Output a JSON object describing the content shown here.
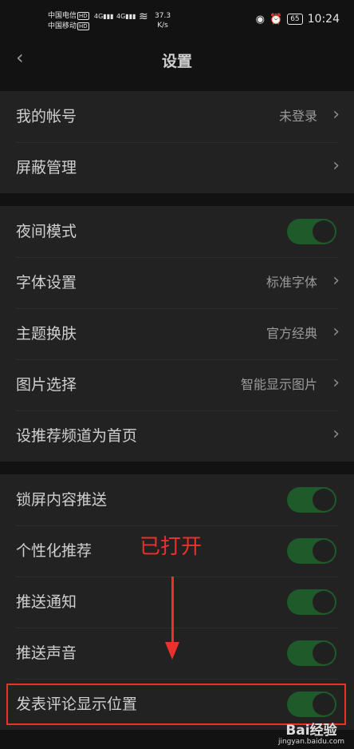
{
  "status": {
    "carrier1": "中国电信",
    "carrier2": "中国移动",
    "hd": "HD",
    "sig": "4G",
    "speed_value": "37.3",
    "speed_unit": "K/s",
    "battery": "65",
    "time": "10:24"
  },
  "header": {
    "back_icon": "chevron-left-icon",
    "title": "设置"
  },
  "groups": [
    {
      "rows": [
        {
          "label": "我的帐号",
          "value": "未登录",
          "type": "link"
        },
        {
          "label": "屏蔽管理",
          "value": "",
          "type": "link"
        }
      ]
    },
    {
      "rows": [
        {
          "label": "夜间模式",
          "type": "toggle",
          "on": true
        },
        {
          "label": "字体设置",
          "value": "标准字体",
          "type": "link"
        },
        {
          "label": "主题换肤",
          "value": "官方经典",
          "type": "link"
        },
        {
          "label": "图片选择",
          "value": "智能显示图片",
          "type": "link"
        },
        {
          "label": "设推荐频道为首页",
          "value": "",
          "type": "link"
        }
      ]
    },
    {
      "rows": [
        {
          "label": "锁屏内容推送",
          "type": "toggle",
          "on": true
        },
        {
          "label": "个性化推荐",
          "type": "toggle",
          "on": true
        },
        {
          "label": "推送通知",
          "type": "toggle",
          "on": true
        },
        {
          "label": "推送声音",
          "type": "toggle",
          "on": true
        },
        {
          "label": "发表评论显示位置",
          "type": "toggle",
          "on": true
        }
      ]
    }
  ],
  "annotation": {
    "text": "已打开",
    "color": "#e8322b"
  },
  "watermark": {
    "brand": "Bai经验",
    "url": "jingyan.baidu.com"
  },
  "colors": {
    "toggle_on": "#1f5a2a",
    "background": "#121212",
    "row_bg": "#222222"
  }
}
